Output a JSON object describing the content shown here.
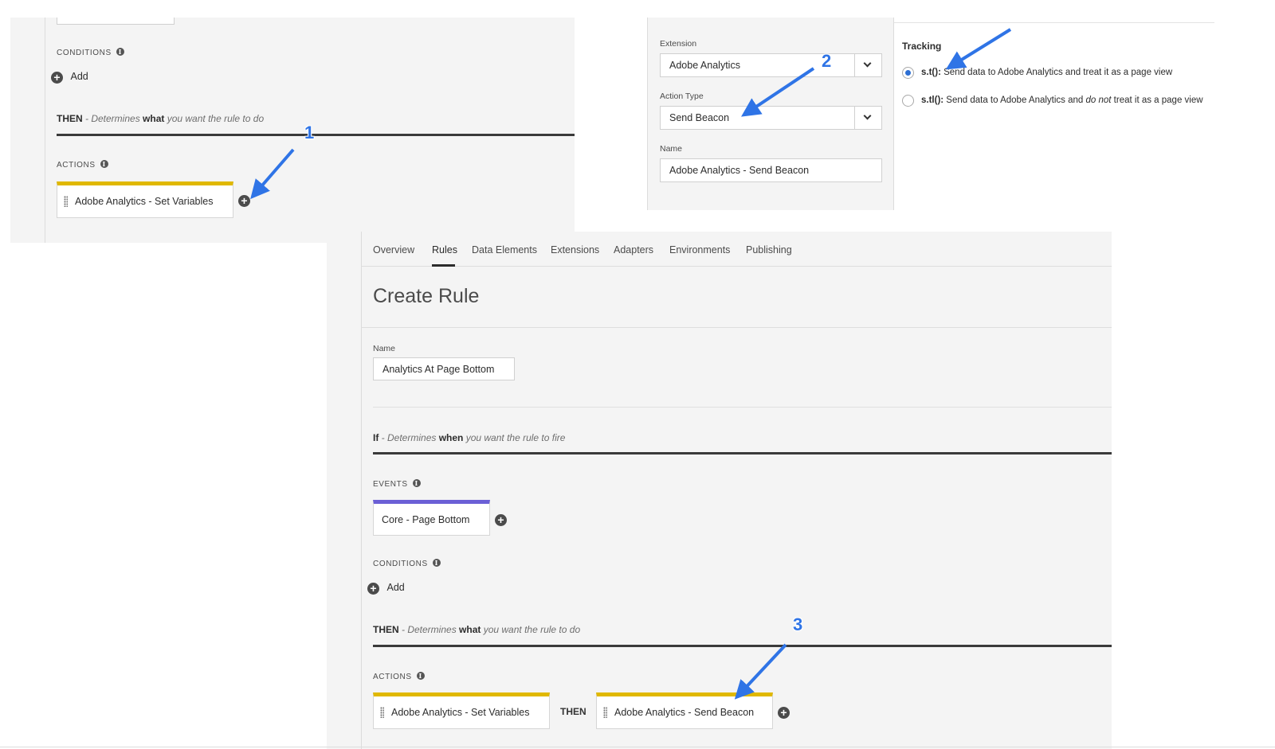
{
  "panel1": {
    "conditions_label": "CONDITIONS",
    "add_label": "Add",
    "then_title": "THEN",
    "then_dash": " - Determines ",
    "then_bold": "what",
    "then_rest": " you want the rule to do",
    "actions_label": "ACTIONS",
    "action_card": "Adobe Analytics - Set Variables",
    "action_color": "#e0b800"
  },
  "panel2": {
    "extension_label": "Extension",
    "extension_value": "Adobe Analytics",
    "action_type_label": "Action Type",
    "action_type_value": "Send Beacon",
    "name_label": "Name",
    "name_value": "Adobe Analytics - Send Beacon",
    "tracking_label": "Tracking",
    "option1_code": "s.t():",
    "option1_text": " Send data to Adobe Analytics and treat it as a page view",
    "option2_code": "s.tl():",
    "option2_text_a": " Send data to Adobe Analytics and ",
    "option2_text_em": "do not",
    "option2_text_b": " treat it as a page view"
  },
  "panel3": {
    "tabs": [
      "Overview",
      "Rules",
      "Data Elements",
      "Extensions",
      "Adapters",
      "Environments",
      "Publishing"
    ],
    "active_tab": "Rules",
    "page_title": "Create Rule",
    "name_label": "Name",
    "name_value": "Analytics At Page Bottom",
    "if_title": "If",
    "if_dash": " - Determines ",
    "if_bold": "when",
    "if_rest": " you want the rule to fire",
    "events_label": "EVENTS",
    "event_card": "Core - Page Bottom",
    "event_color": "#6b5fd6",
    "conditions_label": "CONDITIONS",
    "add_label": "Add",
    "then_title": "THEN",
    "then_dash": " - Determines ",
    "then_bold": "what",
    "then_rest": " you want the rule to do",
    "actions_label": "ACTIONS",
    "action1_card": "Adobe Analytics - Set Variables",
    "then_connector": "THEN",
    "action2_card": "Adobe Analytics - Send Beacon",
    "action_color": "#e0b800"
  },
  "callouts": [
    "1",
    "2",
    "3"
  ],
  "colors": {
    "arrow": "#2f74e6",
    "panel_bg": "#f4f4f4",
    "rule_line": "#3a3a3a"
  }
}
